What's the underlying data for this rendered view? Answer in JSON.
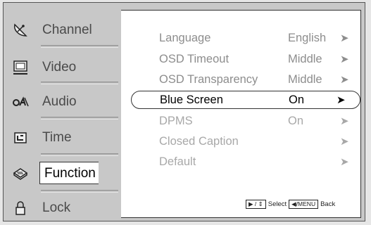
{
  "sidebar": {
    "items": [
      {
        "label": "Channel",
        "icon": "satellite-dish-icon"
      },
      {
        "label": "Video",
        "icon": "monitor-icon"
      },
      {
        "label": "Audio",
        "icon": "audio-icon"
      },
      {
        "label": "Time",
        "icon": "clock-icon"
      },
      {
        "label": "Function",
        "icon": "toolbox-icon",
        "active": true
      },
      {
        "label": "Lock",
        "icon": "padlock-icon"
      }
    ]
  },
  "menu": {
    "rows": [
      {
        "label": "Language",
        "value": "English",
        "arrow": "➤"
      },
      {
        "label": "OSD Timeout",
        "value": "Middle",
        "arrow": "➤"
      },
      {
        "label": "OSD Transparency",
        "value": "Middle",
        "arrow": "➤"
      },
      {
        "label": "Blue Screen",
        "value": "On",
        "arrow": "➤",
        "selected": true
      },
      {
        "label": "DPMS",
        "value": "On",
        "arrow": "➤"
      },
      {
        "label": "Closed Caption",
        "value": "",
        "arrow": "➤"
      },
      {
        "label": "Default",
        "value": "",
        "arrow": "➤"
      }
    ]
  },
  "help": {
    "nav_key": "▶ / ⇕",
    "select_label": "Select",
    "menu_key": "◀/MENU",
    "back_label": "Back"
  }
}
